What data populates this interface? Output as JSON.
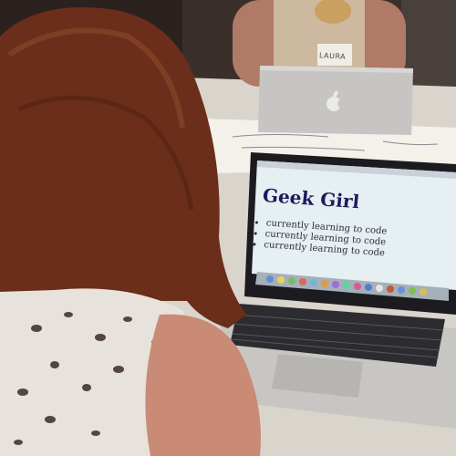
{
  "laptop_screen": {
    "heading": "Geek Girl",
    "bullets": [
      "currently learning to code",
      "currently learning to code",
      "currently learning to code"
    ]
  },
  "name_tag": {
    "text": "LAURA"
  },
  "colors": {
    "hair": "#6b2e1a",
    "screen_bg": "#e6eff2",
    "laptop_silver": "#c9c7c4",
    "keyboard": "#2a2a2e",
    "table": "#d8d4cc"
  },
  "icons": [
    "apple-logo-icon"
  ]
}
